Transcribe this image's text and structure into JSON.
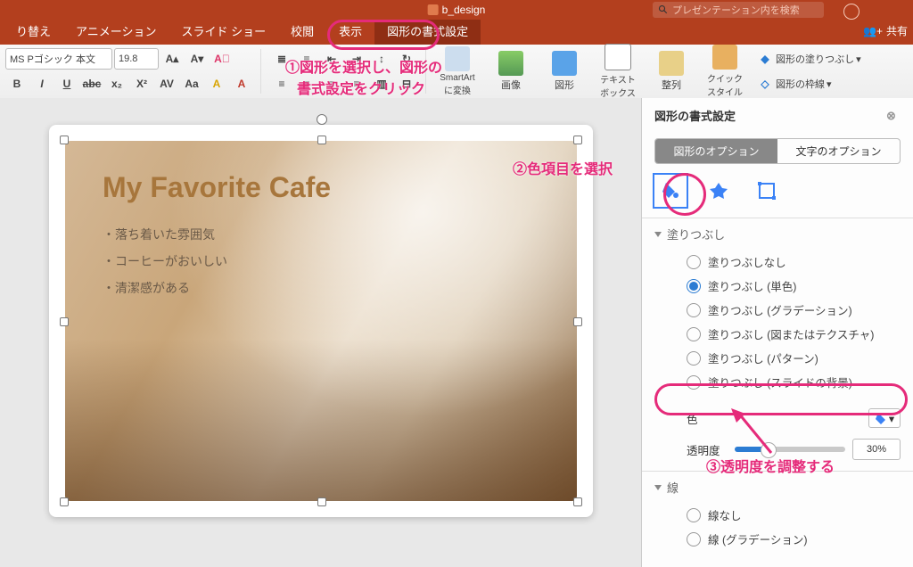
{
  "filename": "b_design",
  "search_placeholder": "プレゼンテーション内を検索",
  "share_label": "共有",
  "tabs": [
    "り替え",
    "アニメーション",
    "スライド ショー",
    "校閲",
    "表示",
    "図形の書式設定"
  ],
  "active_tab": 5,
  "font_name": "MS Pゴシック 本文",
  "font_size": "19.8",
  "ribbon_big": {
    "smartart": "SmartArt\nに変換",
    "image": "画像",
    "shape": "図形",
    "textbox": "テキスト\nボックス",
    "align": "整列",
    "quickstyle": "クイック\nスタイル"
  },
  "ribbon_right": {
    "fill": "図形の塗りつぶし",
    "outline": "図形の枠線"
  },
  "slide": {
    "title": "My Favorite Cafe",
    "bullets": [
      "・落ち着いた雰囲気",
      "・コーヒーがおいしい",
      "・清潔感がある"
    ]
  },
  "pane": {
    "title": "図形の書式設定",
    "seg_shape": "図形のオプション",
    "seg_text": "文字のオプション",
    "fill_header": "塗りつぶし",
    "fill_options": [
      "塗りつぶしなし",
      "塗りつぶし (単色)",
      "塗りつぶし (グラデーション)",
      "塗りつぶし (図またはテクスチャ)",
      "塗りつぶし (パターン)",
      "塗りつぶし (スライドの背景)"
    ],
    "fill_selected": 1,
    "color_label": "色",
    "trans_label": "透明度",
    "trans_value": "30%",
    "line_header": "線",
    "line_options": [
      "線なし",
      "線 (グラデーション)"
    ]
  },
  "annotations": {
    "a1": "①図形を選択し、図形の",
    "a1b": "書式設定をクリック",
    "a2": "②色項目を選択",
    "a3": "③透明度を調整する"
  }
}
